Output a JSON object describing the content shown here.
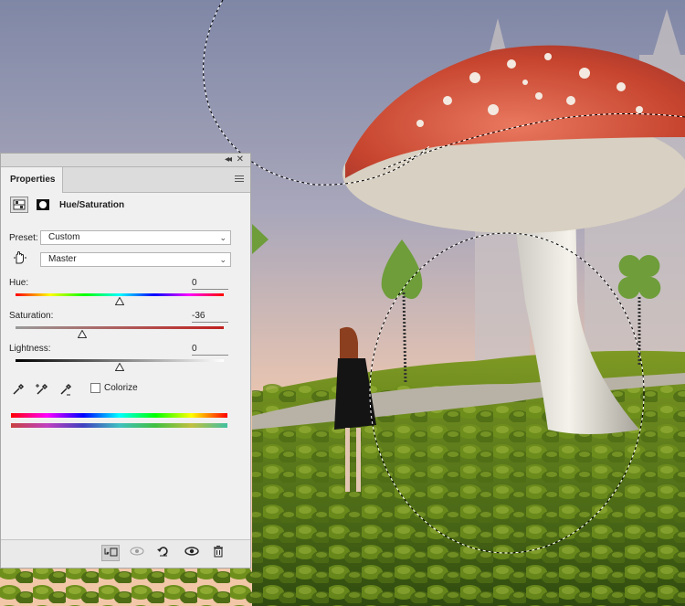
{
  "panel": {
    "tab_label": "Properties",
    "adjustment_title": "Hue/Saturation",
    "preset_label": "Preset:",
    "preset_value": "Custom",
    "channel_value": "Master",
    "hue": {
      "label": "Hue:",
      "value": "0"
    },
    "saturation": {
      "label": "Saturation:",
      "value": "-36"
    },
    "lightness": {
      "label": "Lightness:",
      "value": "0"
    },
    "colorize_label": "Colorize"
  },
  "slider_levels": {
    "hue": 0.5,
    "saturation": 0.32,
    "lightness": 0.5
  },
  "icons": {
    "collapse": "double-chevron-left-icon",
    "close": "close-icon",
    "panel_menu": "hamburger-icon",
    "adjustment": "hue-saturation-icon",
    "mask": "mask-icon",
    "targeted_adjustment": "hand-icon",
    "eyedroppers": [
      "eyedropper-icon",
      "eyedropper-plus-icon",
      "eyedropper-minus-icon"
    ],
    "footer": [
      "clip-to-layer-icon",
      "view-previous-icon",
      "reset-icon",
      "visibility-icon",
      "trash-icon"
    ]
  },
  "colors": {
    "panel_bg": "#f0f0f0",
    "selection": "#000000"
  }
}
